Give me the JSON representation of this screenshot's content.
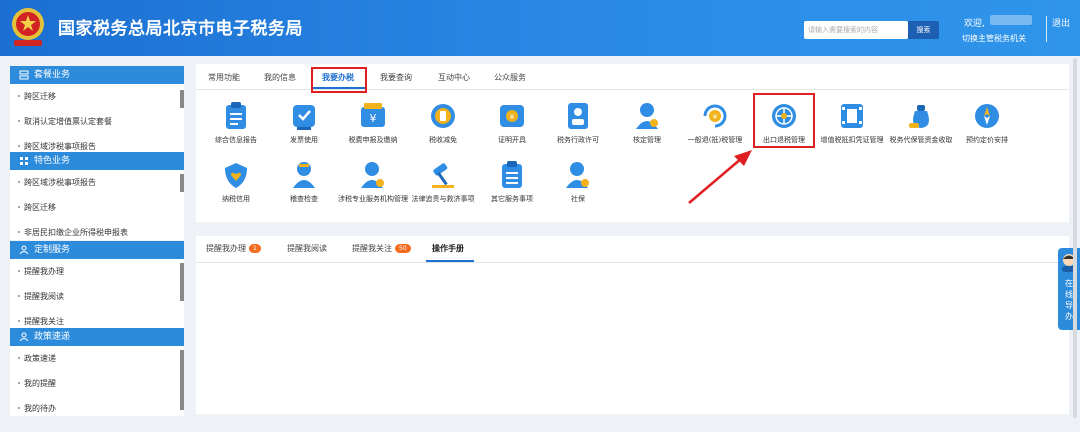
{
  "header": {
    "site_title": "国家税务总局北京市电子税务局",
    "search_placeholder": "请输入需要搜索的内容",
    "search_button": "搜索",
    "welcome": "欢迎,",
    "switch_office": "切换主管税务机关",
    "logout": "退出",
    "emblem_icon": "tax-emblem-icon"
  },
  "sidebar": {
    "panels": [
      {
        "title": "套餐业务",
        "items": [
          "跨区迁移",
          "取消认定增值票认定套餐",
          "跨区域涉税事项报告"
        ]
      },
      {
        "title": "特色业务",
        "items": [
          "跨区域涉税事项报告",
          "跨区迁移",
          "非居民扣缴企业所得税申报表"
        ]
      },
      {
        "title": "定制服务",
        "items": [
          "提醒我办理",
          "提醒我阅读",
          "提醒我关注"
        ]
      },
      {
        "title": "政策速递",
        "items": [
          "政策速递",
          "我的提醒",
          "我的待办"
        ]
      }
    ]
  },
  "main": {
    "tabs": [
      "常用功能",
      "我的信息",
      "我要办税",
      "我要查询",
      "互动中心",
      "公众服务"
    ],
    "active_tab": "我要办税",
    "services_row1": [
      "综合信息报告",
      "发票使用",
      "税费申报及缴纳",
      "税收减免",
      "证明开具",
      "税务行政许可",
      "核定管理",
      "一般退(抵)税管理",
      "出口退税管理",
      "增值税抵扣凭证管理",
      "税务代保管资金收取",
      "预约定价安排"
    ],
    "services_row2": [
      "纳税信用",
      "稽查检查",
      "涉税专业服务机构管理",
      "法律追责与救济事项",
      "其它服务事项",
      "社保"
    ],
    "highlighted_service": "出口退税管理"
  },
  "bottom_tabs": {
    "items": [
      "提醒我办理",
      "提醒我阅读",
      "提醒我关注",
      "操作手册"
    ],
    "badges": {
      "提醒我办理": "1",
      "提醒我关注": "50"
    },
    "active": "操作手册"
  },
  "float_help": "在线导办",
  "colors": {
    "header_blue": "#1c6fd1",
    "panel_blue": "#2d8bdb",
    "accent_red": "#e02020",
    "badge_orange": "#f36c21"
  }
}
